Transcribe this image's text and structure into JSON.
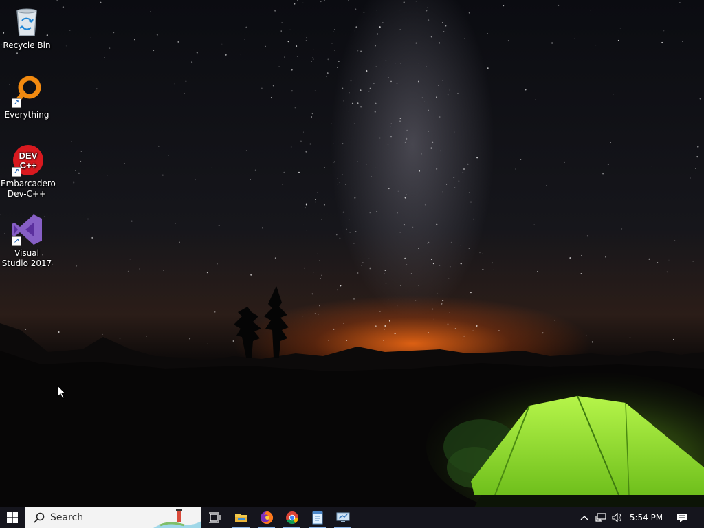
{
  "desktop": {
    "icons": [
      {
        "label": "Recycle Bin",
        "icon": "recycle-bin-icon"
      },
      {
        "label": "Everything",
        "icon": "everything-search-icon",
        "shortcut": true
      },
      {
        "label": "Embarcadero Dev-C++",
        "icon": "devcpp-icon",
        "shortcut": true,
        "badge_line1": "DEV",
        "badge_line2": "C++"
      },
      {
        "label": "Visual Studio 2017",
        "icon": "visual-studio-icon",
        "shortcut": true
      }
    ]
  },
  "taskbar": {
    "search_label": "Search",
    "apps": [
      {
        "name": "Task View",
        "icon": "task-view-icon"
      },
      {
        "name": "File Explorer",
        "icon": "file-explorer-icon",
        "running": true
      },
      {
        "name": "Firefox",
        "icon": "firefox-icon",
        "running": true
      },
      {
        "name": "Chrome",
        "icon": "chrome-icon",
        "running": true
      },
      {
        "name": "Notepad",
        "icon": "notepad-icon",
        "running": true
      },
      {
        "name": "Remote Desktop",
        "icon": "remote-desktop-icon",
        "running": true
      }
    ],
    "tray": {
      "time": "5:54 PM",
      "icons": [
        "chevron-up-icon",
        "network-icon",
        "volume-icon"
      ]
    }
  },
  "colors": {
    "taskbar_bg": "#15151d",
    "search_bg": "#f3f3f3",
    "windows_blue": "#0078d7",
    "running_indicator": "#8ab4e8",
    "tent_green": "#7ed321",
    "glow_orange": "#ff6e14"
  }
}
